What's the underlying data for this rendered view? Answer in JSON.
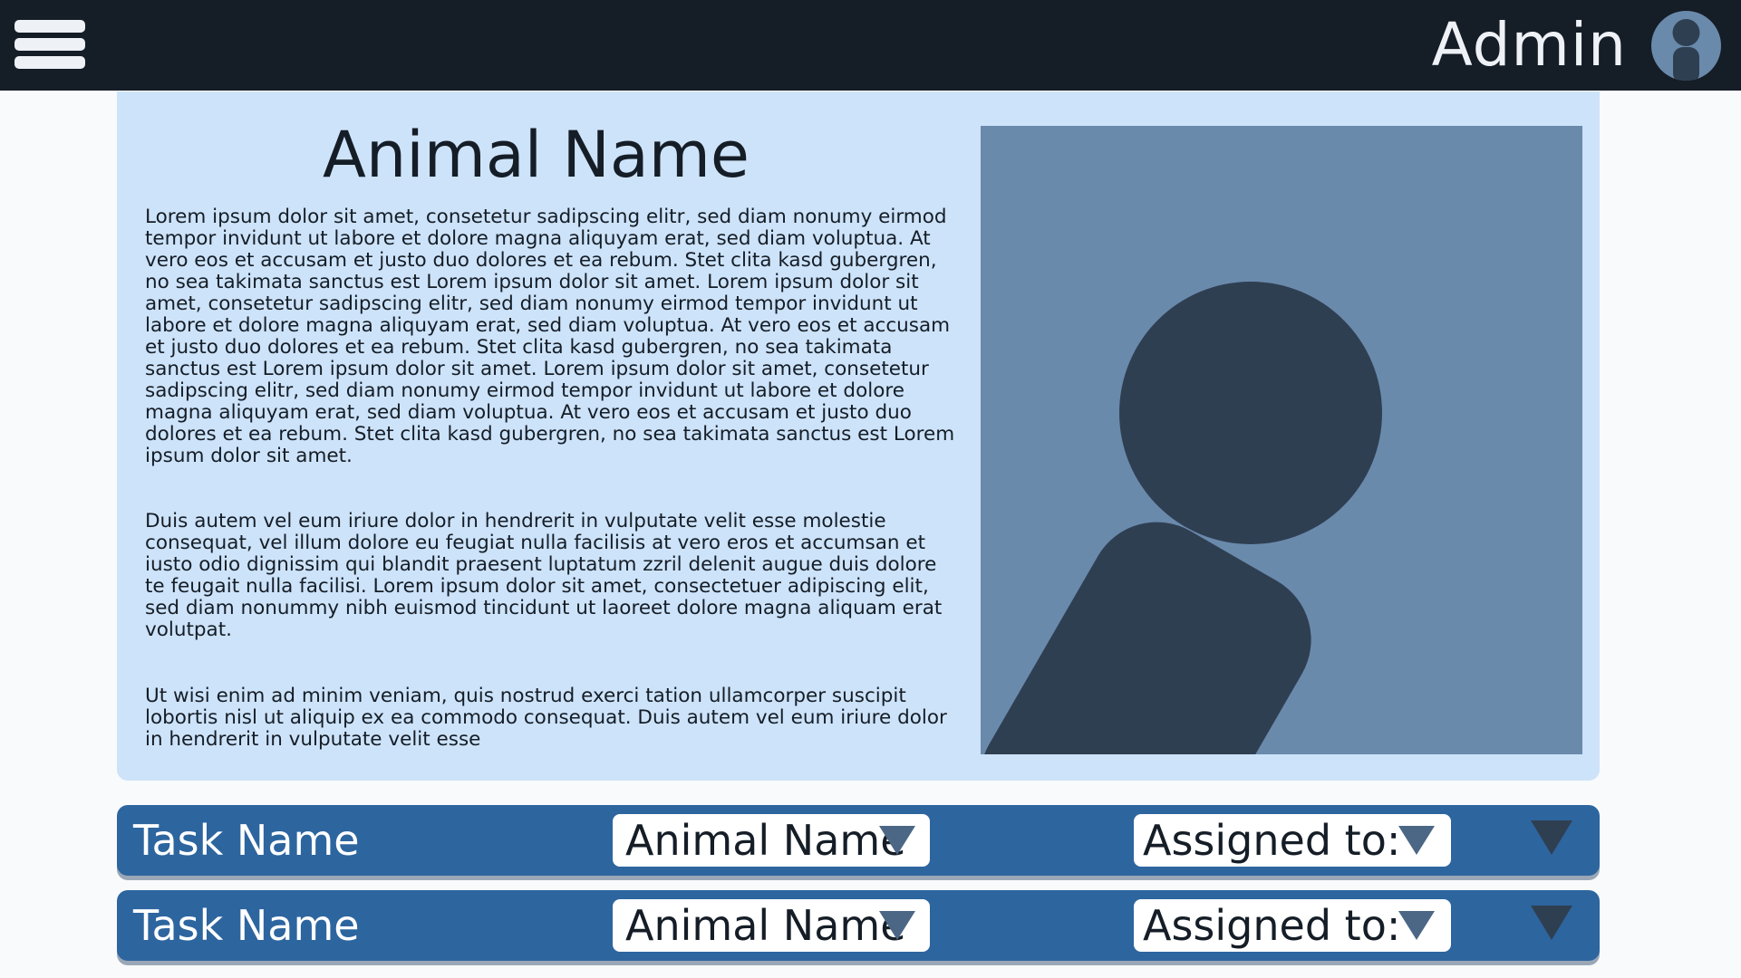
{
  "header": {
    "menu_icon": "hamburger-menu-icon",
    "user_name": "Admin",
    "avatar_icon": "user-avatar-icon"
  },
  "animal_profile": {
    "title": "Animal Name",
    "paragraphs": [
      "Lorem ipsum dolor sit amet, consetetur sadipscing elitr, sed diam nonumy eirmod tempor invidunt ut labore et dolore magna aliquyam erat, sed diam voluptua. At vero eos et accusam et justo duo dolores et ea rebum. Stet clita kasd gubergren, no sea takimata sanctus est Lorem ipsum dolor sit amet. Lorem ipsum dolor sit amet, consetetur sadipscing elitr, sed diam nonumy eirmod tempor invidunt ut labore et dolore magna aliquyam erat, sed diam voluptua. At vero eos et accusam et justo duo dolores et ea rebum. Stet clita kasd gubergren, no sea takimata sanctus est Lorem ipsum dolor sit amet. Lorem ipsum dolor sit amet, consetetur sadipscing elitr, sed diam nonumy eirmod tempor invidunt ut labore et dolore magna aliquyam erat, sed diam voluptua. At vero eos et accusam et justo duo dolores et ea rebum. Stet clita kasd gubergren, no sea takimata sanctus est Lorem ipsum dolor sit amet.",
      "Duis autem vel eum iriure dolor in hendrerit in vulputate velit esse molestie consequat, vel illum dolore eu feugiat nulla facilisis at vero eros et accumsan et iusto odio dignissim qui blandit praesent luptatum zzril delenit augue duis dolore te feugait nulla facilisi. Lorem ipsum dolor sit amet, consectetuer adipiscing elit, sed diam nonummy nibh euismod tincidunt ut laoreet dolore magna aliquam erat volutpat.",
      "Ut wisi enim ad minim veniam, quis nostrud exerci tation ullamcorper suscipit lobortis nisl ut aliquip ex ea commodo consequat. Duis autem vel eum iriure dolor in hendrerit in vulputate velit esse"
    ],
    "photo_icon": "person-placeholder-icon"
  },
  "tasks": [
    {
      "name": "Task Name",
      "animal_select": "Animal Name",
      "assignee_select": "Assigned to:"
    },
    {
      "name": "Task Name",
      "animal_select": "Animal Name",
      "assignee_select": "Assigned to:"
    }
  ],
  "colors": {
    "header_bg": "#151d27",
    "card_bg": "#cde3f9",
    "photo_bg": "#6a8aac",
    "placeholder_figure": "#2f3f52",
    "task_row_bg": "#2d659f",
    "arrow": "#4b6785"
  }
}
